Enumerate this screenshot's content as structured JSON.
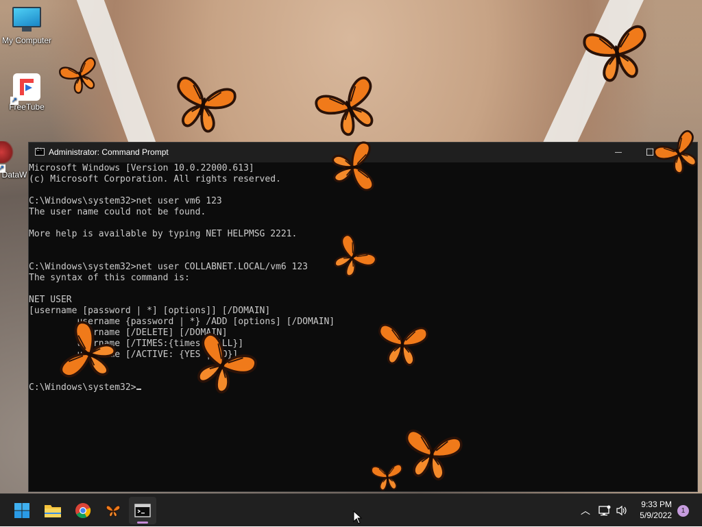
{
  "desktop": {
    "icons": [
      {
        "label": "My Computer",
        "icon": "monitor-icon"
      },
      {
        "label": "FreeTube",
        "icon": "freetube-icon"
      },
      {
        "label": "DataW",
        "icon": "dataw-icon"
      }
    ]
  },
  "window": {
    "title": "Administrator: Command Prompt",
    "icon": "cmd-icon",
    "controls": {
      "minimize": "—",
      "maximize": "☐",
      "close": "✕"
    }
  },
  "terminal": {
    "lines": [
      "Microsoft Windows [Version 10.0.22000.613]",
      "(c) Microsoft Corporation. All rights reserved.",
      "",
      "C:\\Windows\\system32>net user vm6 123",
      "The user name could not be found.",
      "",
      "More help is available by typing NET HELPMSG 2221.",
      "",
      "",
      "C:\\Windows\\system32>net user COLLABNET.LOCAL/vm6 123",
      "The syntax of this command is:",
      "",
      "NET USER",
      "[username [password | *] [options]] [/DOMAIN]",
      "         username {password | *} /ADD [options] [/DOMAIN]",
      "         username [/DELETE] [/DOMAIN]",
      "         username [/TIMES:{times | ALL}]",
      "         username [/ACTIVE: {YES | NO}]",
      "",
      "",
      "C:\\Windows\\system32>"
    ]
  },
  "taskbar": {
    "apps": [
      {
        "name": "start-button",
        "icon": "windows-logo-icon"
      },
      {
        "name": "file-explorer",
        "icon": "folder-icon"
      },
      {
        "name": "chrome",
        "icon": "chrome-icon"
      },
      {
        "name": "butterfly-app",
        "icon": "butterfly-icon"
      },
      {
        "name": "command-prompt",
        "icon": "terminal-icon"
      }
    ],
    "tray": {
      "time": "9:33 PM",
      "date": "5/9/2022",
      "notification_count": "1"
    }
  },
  "colors": {
    "terminal_bg": "#0c0c0c",
    "terminal_fg": "#cccccc",
    "titlebar_bg": "#1f1f1f",
    "taskbar_bg": "#202020",
    "butterfly_orange": "#f07a1a"
  }
}
